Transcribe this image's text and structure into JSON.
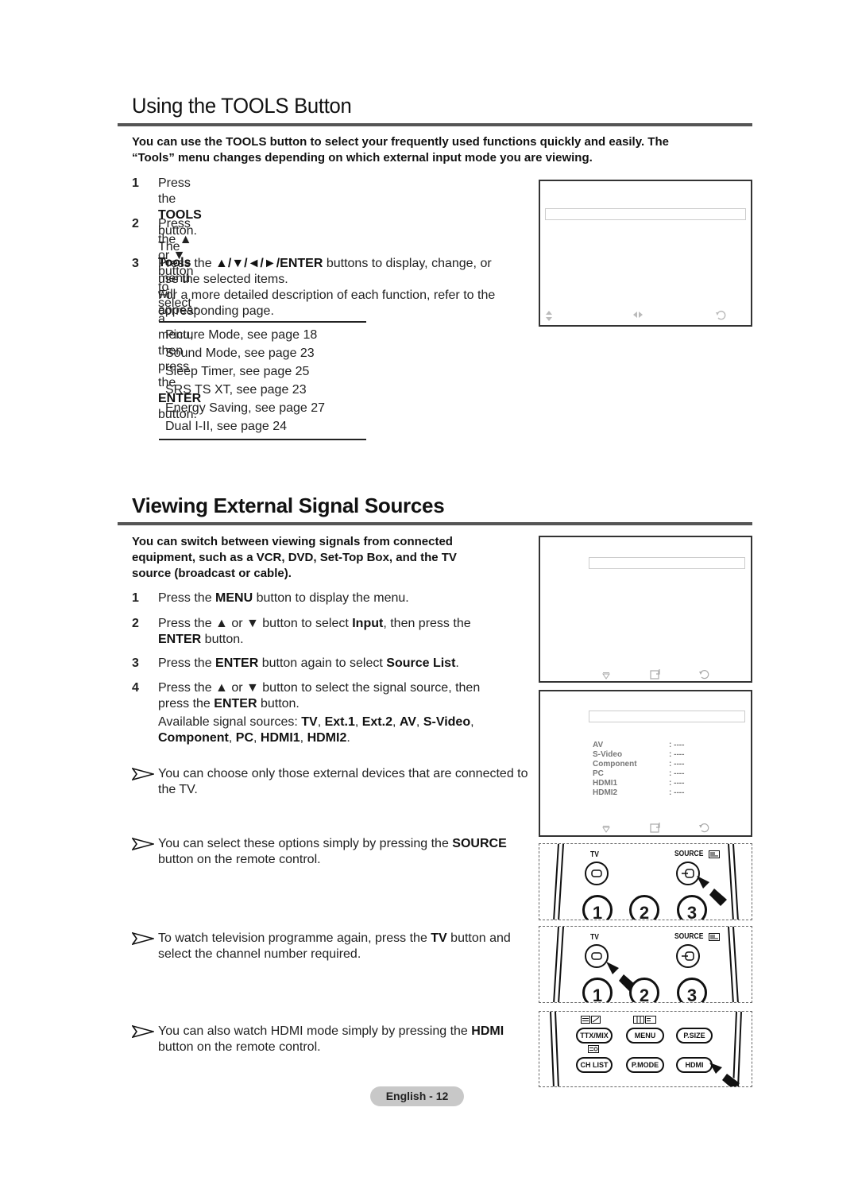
{
  "section1": {
    "title": "Using the TOOLS Button",
    "intro_line1": "You can use the TOOLS button to select your frequently used functions quickly and easily. The",
    "intro_line2": "“Tools” menu changes depending on which external input mode you are viewing.",
    "steps": [
      {
        "num": "1",
        "parts": [
          [
            "Press the ",
            false
          ],
          [
            "TOOLS",
            true
          ],
          [
            " button.",
            false
          ]
        ],
        "line2": [
          [
            "The ",
            false
          ],
          [
            "Tools",
            true
          ],
          [
            " menu will appear.",
            false
          ]
        ]
      },
      {
        "num": "2",
        "line1": "Press the ▲ or ▼ button to select a menu, then press the",
        "line2_bold": "ENTER",
        "line2_rest": " button."
      },
      {
        "num": "3",
        "line1_pre": "Press the ",
        "line1_bold": "▲/▼/◄/►/ENTER",
        "line1_rest": " buttons to display, change, or",
        "line2": "use the selected items.",
        "line3": "For a more detailed description of each function, refer to the",
        "line4": "corresponding page."
      }
    ],
    "references": [
      "Picture Mode, see page 18",
      "Sound Mode, see page 23",
      "Sleep Timer, see page 25",
      "SRS TS XT, see page 23",
      "Energy Saving, see page 27",
      "Dual I-II, see page 24"
    ],
    "screen_icons": [
      "up-down-icon",
      "left-right-icon",
      "return-icon"
    ]
  },
  "section2": {
    "title": "Viewing External Signal Sources",
    "intro": [
      "You can switch between viewing signals from connected",
      "equipment, such as a VCR, DVD, Set-Top Box, and the TV",
      "source (broadcast or cable)."
    ],
    "step1": {
      "num": "1",
      "pre": "Press the ",
      "bold": "MENU",
      "rest": " button to display the menu."
    },
    "step2": {
      "num": "2",
      "pre": "Press the ▲ or ▼ button to select ",
      "bold": "Input",
      "rest": ", then press the",
      "l2bold": "ENTER",
      "l2rest": " button."
    },
    "step3": {
      "num": "3",
      "pre": "Press the ",
      "bold": "ENTER",
      "mid": " button again to select ",
      "bold2": "Source List",
      "rest": "."
    },
    "step4": {
      "num": "4",
      "line1": "Press the ▲ or ▼ button to select the signal source, then",
      "l2pre": "press the ",
      "l2bold": "ENTER",
      "l2rest": " button.",
      "avail_label": "Available signal sources: ",
      "sources": [
        "TV",
        "Ext.1",
        "Ext.2",
        "AV",
        "S-Video",
        "Component",
        "PC",
        "HDMI1",
        "HDMI2"
      ]
    },
    "notes": [
      {
        "line1": "You can choose only those external devices that are connected",
        "line2": "to the TV."
      },
      {
        "line1_pre": "You can select these options simply by pressing the ",
        "line1_bold": "SOURCE",
        "line2": "button on the remote control."
      },
      {
        "line1_pre": "To watch television programme again, press the ",
        "line1_bold": "TV",
        "line1_rest": " button and",
        "line2": "select the channel number required."
      },
      {
        "line1_pre": "You can also watch HDMI mode simply by pressing the ",
        "line1_bold": "HDMI",
        "line2": "button on the remote control."
      }
    ],
    "source_list": [
      {
        "name": "AV",
        "value": ": ----"
      },
      {
        "name": "S-Video",
        "value": ": ----"
      },
      {
        "name": "Component",
        "value": ": ----"
      },
      {
        "name": "PC",
        "value": ": ----"
      },
      {
        "name": "HDMI1",
        "value": ": ----"
      },
      {
        "name": "HDMI2",
        "value": ": ----"
      }
    ],
    "remote1": {
      "tv": "TV",
      "source": "SOURCE",
      "nums": [
        "1",
        "2",
        "3"
      ]
    },
    "remote2": {
      "tv": "TV",
      "source": "SOURCE",
      "nums": [
        "1",
        "2",
        "3"
      ]
    },
    "remote3": {
      "buttons": [
        "TTX/MIX",
        "MENU",
        "P.SIZE",
        "CH LIST",
        "P.MODE",
        "HDMI"
      ]
    }
  },
  "footer": {
    "page_label": "English - 12"
  }
}
